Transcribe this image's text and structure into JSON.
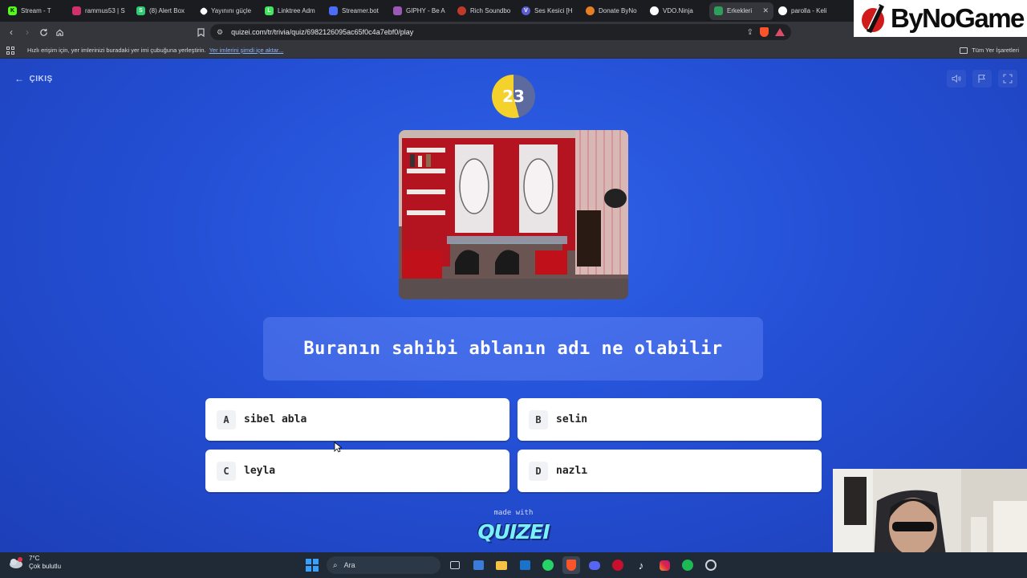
{
  "browser": {
    "tabs": [
      {
        "label": "Stream - T",
        "color": "#53fc18",
        "glyph": "K"
      },
      {
        "label": "rammus53 | S",
        "color": "#d0306b",
        "glyph": ""
      },
      {
        "label": "(8) Alert Box",
        "color": "#2ecc71",
        "glyph": "S"
      },
      {
        "label": "Yayınını güçle",
        "color": "#ffffff",
        "glyph": ""
      },
      {
        "label": "Linktree Adm",
        "color": "#43e55e",
        "glyph": "L"
      },
      {
        "label": "Streamer.bot",
        "color": "#4a6cf7",
        "glyph": ""
      },
      {
        "label": "GIPHY - Be A",
        "color": "#9b59b6",
        "glyph": ""
      },
      {
        "label": "Rich Soundbo",
        "color": "#c0392b",
        "glyph": ""
      },
      {
        "label": "Ses Kesici [H",
        "color": "#5b5bd6",
        "glyph": "V"
      },
      {
        "label": "Donate ByNo",
        "color": "#e67e22",
        "glyph": ""
      },
      {
        "label": "VDO.Ninja",
        "color": "#ffffff",
        "glyph": ""
      },
      {
        "label": "Erkekleri",
        "color": "#2e9e5b",
        "glyph": ""
      },
      {
        "label": "parolla - Keli",
        "color": "#ffffff",
        "glyph": ""
      }
    ],
    "active_tab_index": 11,
    "url": "quizei.com/tr/trivia/quiz/6982126095ac65f0c4a7ebf0/play",
    "bookmarks_hint": "Hızlı erişim için, yer imlerinizi buradaki yer imi çubuğuna yerleştirin.",
    "bookmarks_link": "Yer imlerini şimdi içe aktar...",
    "all_bookmarks": "Tüm Yer İşaretleri"
  },
  "quiz": {
    "exit_label": "ÇIKIŞ",
    "timer": "23",
    "question": "Buranın sahibi ablanın adı ne olabilir",
    "answers": [
      {
        "letter": "A",
        "text": "sibel abla"
      },
      {
        "letter": "B",
        "text": "selin"
      },
      {
        "letter": "C",
        "text": "leyla"
      },
      {
        "letter": "D",
        "text": "nazlı"
      }
    ],
    "made_with": "made with",
    "brand": "QUIZEI"
  },
  "overlay": {
    "logo_text": "ByNoGame"
  },
  "taskbar": {
    "temperature": "7°C",
    "weather": "Çok bulutlu",
    "search_placeholder": "Ara"
  },
  "colors": {
    "page_bg": "#2450d6",
    "timer_yellow": "#f4d12b",
    "brand_cyan": "#79f0ff"
  }
}
